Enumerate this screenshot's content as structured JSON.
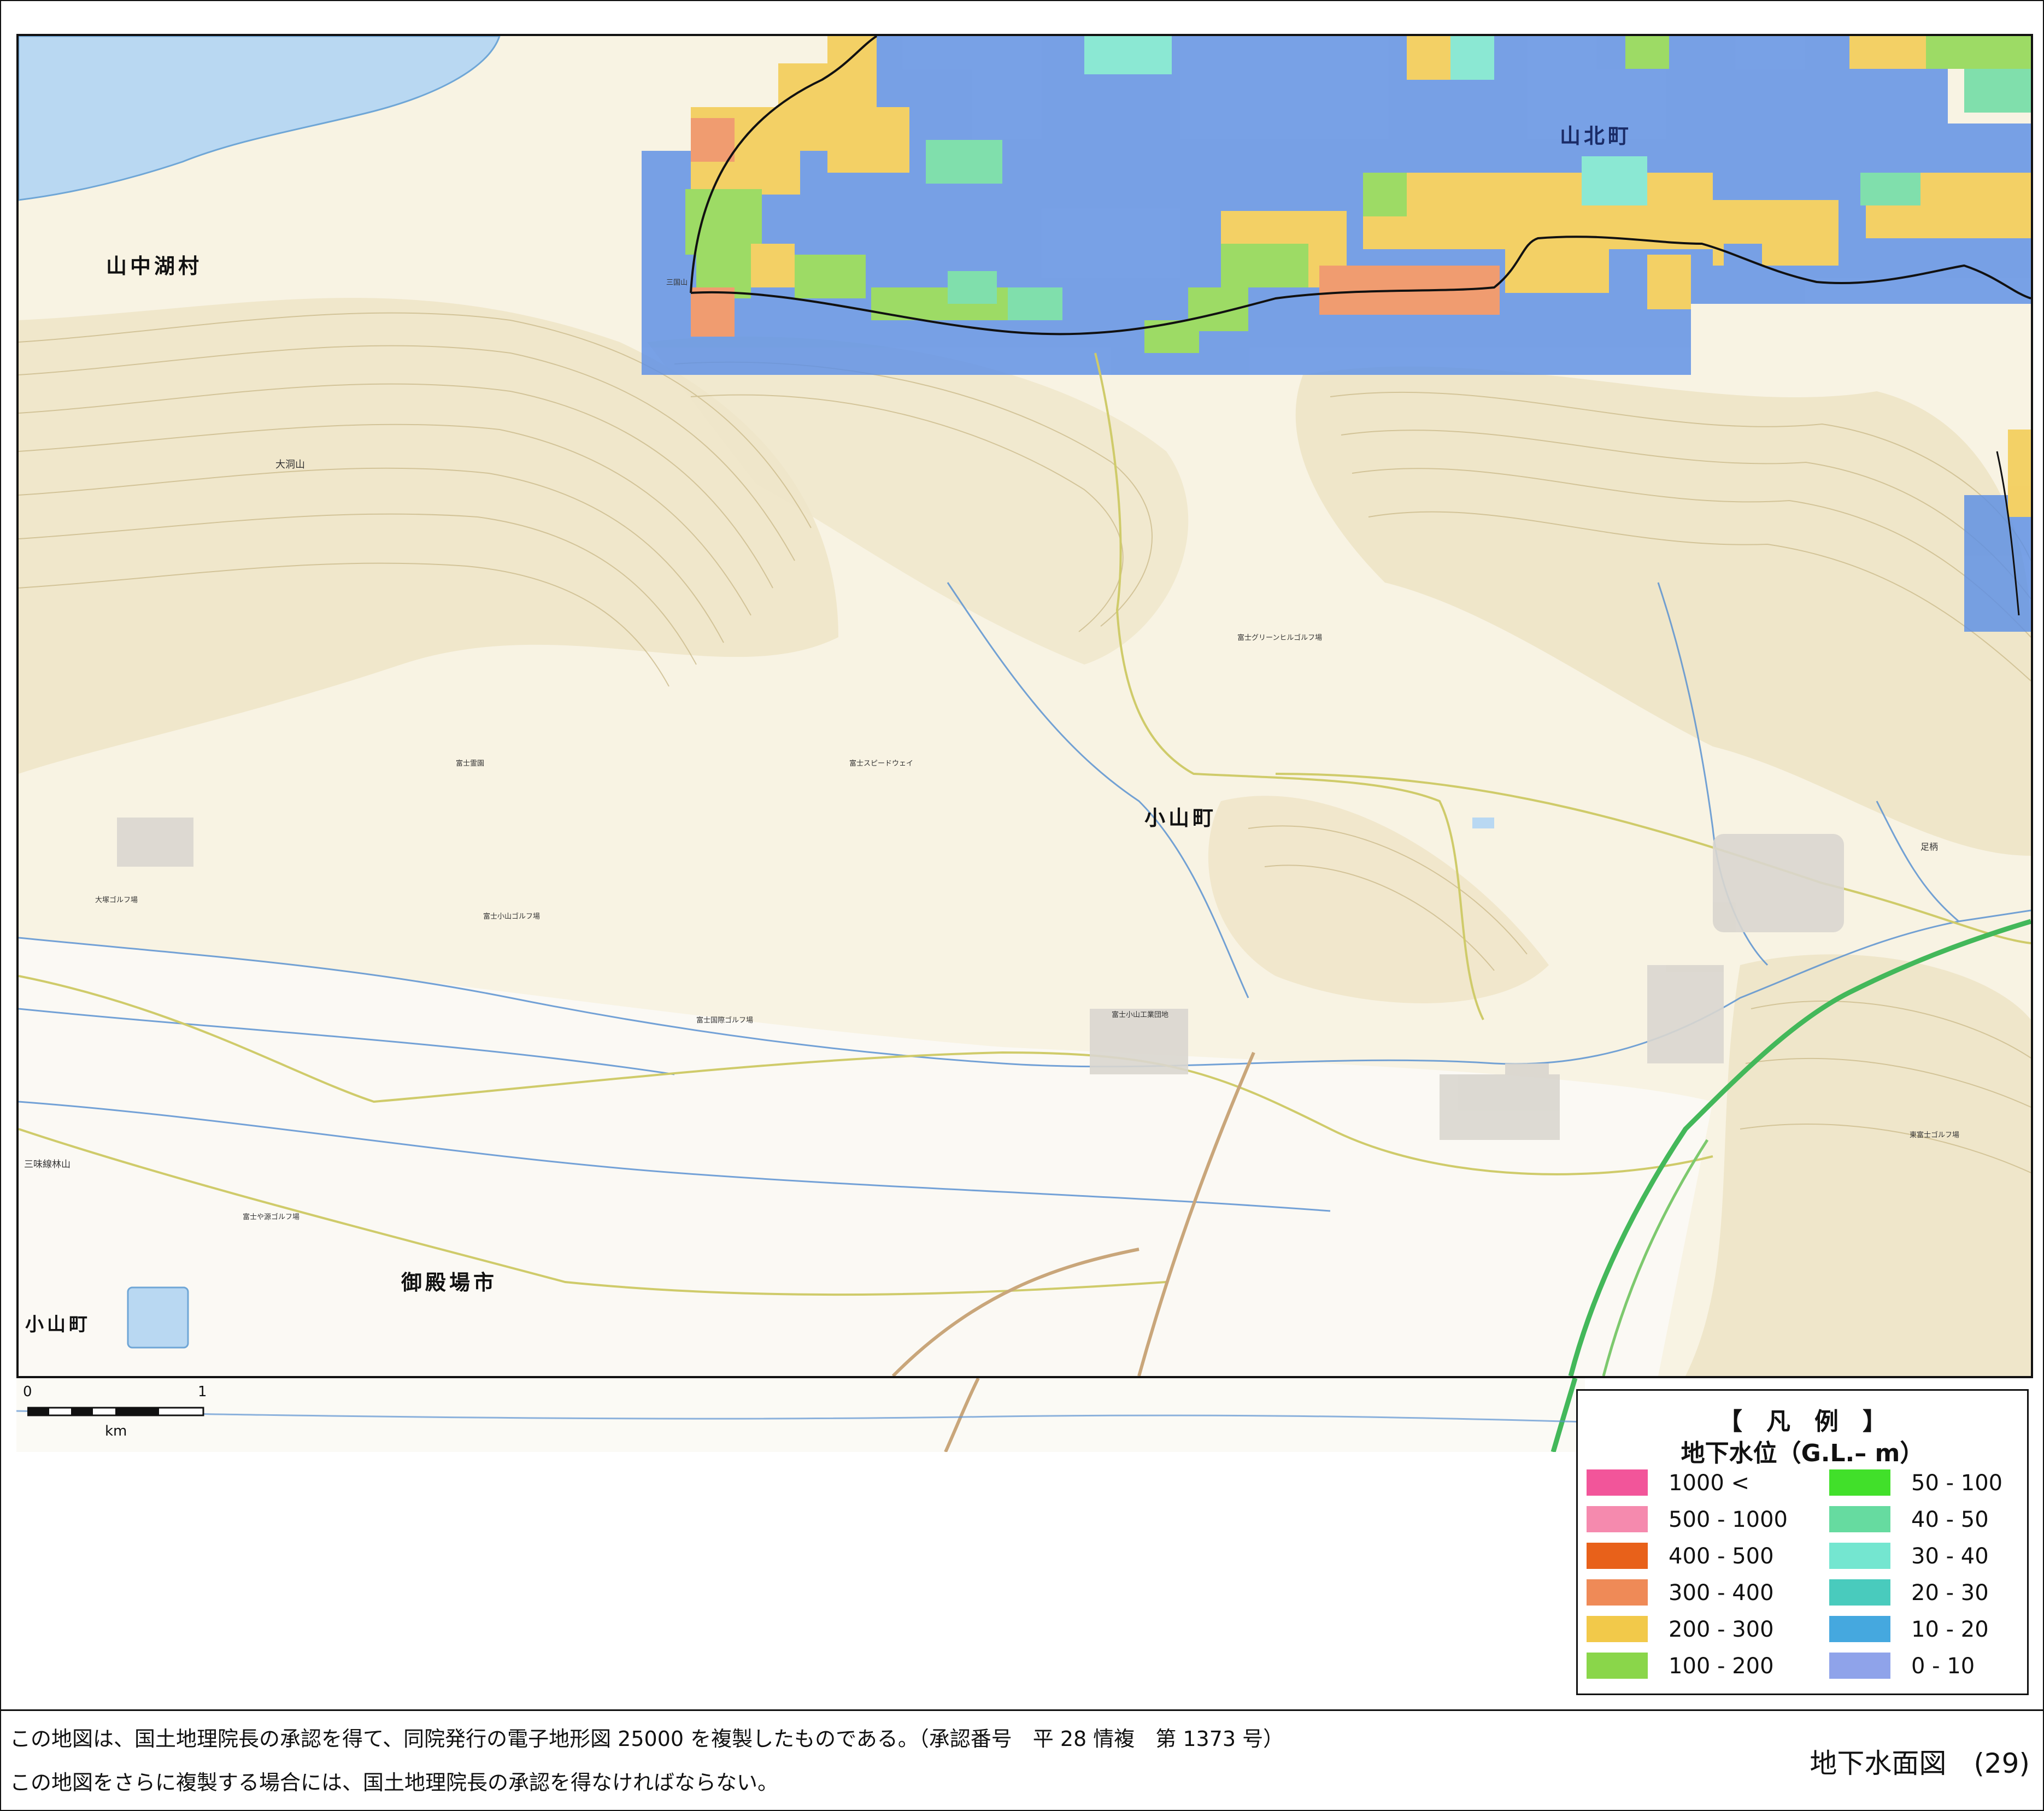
{
  "map": {
    "places": {
      "yamanakako": "山中湖村",
      "yamakita": "山北町",
      "oyama_center": "小山町",
      "gotemba": "御殿場市",
      "oyama_sw": "小山町"
    },
    "features": {
      "mikuni_yama": "三国山",
      "ohora_yama": "大洞山",
      "fuji_speedway": "富士スピードウェイ",
      "fuji_green_hill_golf": "富士グリーンヒルゴルフ場",
      "fuji_oyama_golf": "富士小山ゴルフ場",
      "fuji_kokusai_golf": "富士国際ゴルフ場",
      "ohira_golf": "大塚ゴルフ場",
      "fujiyama_golf": "富士や源ゴルフ場",
      "sanmi_rinsan": "三味線林山",
      "fuji_reien": "富士霊園",
      "fuji_oyama_industrial": "富士小山工業団地",
      "tokyo_fuji_golf": "東富士ゴルフ場",
      "adachi": "足柄"
    },
    "scale": {
      "zero": "0",
      "one": "1",
      "unit": "km"
    }
  },
  "legend": {
    "title": "【　凡　例　】",
    "subtitle": "地下水位（G.L.– m）",
    "items": [
      {
        "label": "1000 <",
        "color": "#f2559a"
      },
      {
        "label": "500 - 1000",
        "color": "#f58aae"
      },
      {
        "label": "400 - 500",
        "color": "#e8611a"
      },
      {
        "label": "300 - 400",
        "color": "#ef8a57"
      },
      {
        "label": "200 - 300",
        "color": "#f2c94a"
      },
      {
        "label": "100 - 200",
        "color": "#8ad64a"
      },
      {
        "label": "50 - 100",
        "color": "#41e02a"
      },
      {
        "label": "40 - 50",
        "color": "#66dba0"
      },
      {
        "label": "30 - 40",
        "color": "#74e6d0"
      },
      {
        "label": "20 - 30",
        "color": "#49cbbd"
      },
      {
        "label": "10 - 20",
        "color": "#45a8df"
      },
      {
        "label": "0 - 10",
        "color": "#8fa3ea"
      }
    ]
  },
  "footer": {
    "line1": "この地図は、国土地理院長の承認を得て、同院発行の電子地形図 25000 を複製したものである。（承認番号　平 28 情複　第 1373 号）",
    "line2": "この地図をさらに複製する場合には、国土地理院長の承認を得なければならない。",
    "sheet_title": "地下水面図　(29)"
  }
}
